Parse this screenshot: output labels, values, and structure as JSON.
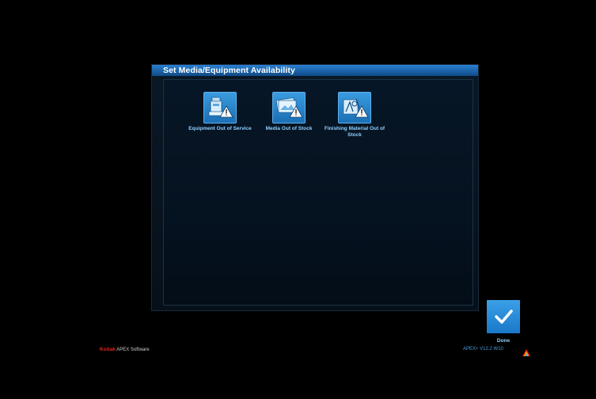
{
  "dialog": {
    "title": "Set Media/Equipment Availability",
    "tiles": [
      {
        "label": "Equipment Out of Service",
        "icon": "equipment-warning-icon"
      },
      {
        "label": "Media Out of Stock",
        "icon": "media-warning-icon"
      },
      {
        "label": "Finishing Material Out of Stock",
        "icon": "finishing-material-warning-icon"
      }
    ]
  },
  "done": {
    "label": "Done",
    "icon": "checkmark-icon"
  },
  "footer": {
    "brand": "Kodak",
    "product": "APEX Software",
    "version": "APEX+ V12.2  W10",
    "logo_icon": "kodak-triangle-logo-icon"
  },
  "colors": {
    "title_bar": "#1f6bb8",
    "tile_label": "#8fd0ff",
    "done_button": "#2a8cde",
    "kodak_red": "#e2231a"
  }
}
